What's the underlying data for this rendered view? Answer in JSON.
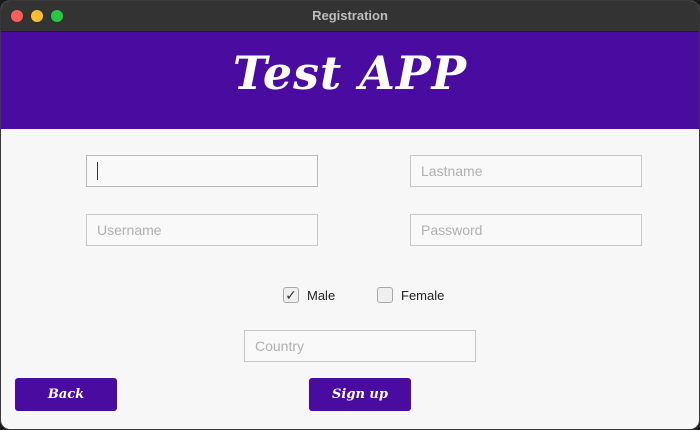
{
  "window": {
    "title": "Registration"
  },
  "header": {
    "app_title": "Test APP"
  },
  "form": {
    "firstname": {
      "value": "",
      "placeholder": ""
    },
    "lastname": {
      "value": "",
      "placeholder": "Lastname"
    },
    "username": {
      "value": "",
      "placeholder": "Username"
    },
    "password": {
      "value": "",
      "placeholder": "Password"
    },
    "gender": {
      "male": {
        "label": "Male",
        "checked": true,
        "mark": "✓"
      },
      "female": {
        "label": "Female",
        "checked": false,
        "mark": ""
      }
    },
    "country": {
      "value": "",
      "placeholder": "Country"
    }
  },
  "buttons": {
    "back": "Back",
    "signup": "Sign up"
  },
  "colors": {
    "accent": "#4a0ba0"
  }
}
